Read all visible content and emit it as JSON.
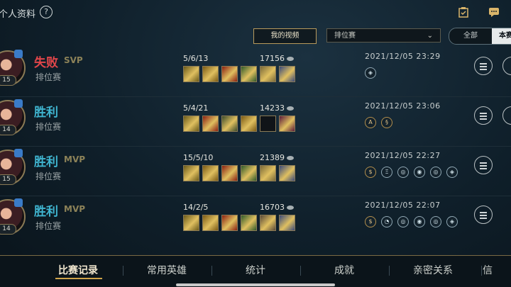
{
  "header": {
    "title": "个人资料",
    "help": "?",
    "video_btn": "我的视频",
    "dropdown_value": "排位赛",
    "seg_all": "全部",
    "seg_this": "本赛"
  },
  "matches": [
    {
      "result": "失败",
      "tag": "SVP",
      "mode": "排位赛",
      "kda": "5/6/13",
      "gold": "17156",
      "date": "2021/12/05 23:29",
      "level": "15",
      "items": [
        "#6b5a1a",
        "#7a5a15",
        "#8a1f12",
        "#2f5a2a",
        "#7a6a3a",
        "#3b4a7a"
      ],
      "icons": [
        {
          "t": "◈",
          "g": false
        }
      ]
    },
    {
      "result": "胜利",
      "tag": "",
      "mode": "排位赛",
      "kda": "5/4/21",
      "gold": "14233",
      "date": "2021/12/05 23:06",
      "level": "14",
      "items": [
        "#6b5a1a",
        "#8a1f12",
        "#3a4a2a",
        "#7a5a15",
        "#101418",
        "#5a1a3a"
      ],
      "icons": [
        {
          "t": "A",
          "g": true
        },
        {
          "t": "§",
          "g": true
        }
      ]
    },
    {
      "result": "胜利",
      "tag": "MVP",
      "mode": "排位赛",
      "kda": "15/5/10",
      "gold": "21389",
      "date": "2021/12/05 22:27",
      "level": "15",
      "items": [
        "#6b5a1a",
        "#7a5a15",
        "#8a1f12",
        "#2f5a2a",
        "#7a6a3a",
        "#3b4a7a"
      ],
      "icons": [
        {
          "t": "$",
          "g": true
        },
        {
          "t": "Ξ",
          "g": false
        },
        {
          "t": "◎",
          "g": false
        },
        {
          "t": "◉",
          "g": false
        },
        {
          "t": "◎",
          "g": false
        },
        {
          "t": "◈",
          "g": false
        }
      ]
    },
    {
      "result": "胜利",
      "tag": "MVP",
      "mode": "排位赛",
      "kda": "14/2/5",
      "gold": "16703",
      "date": "2021/12/05 22:07",
      "level": "14",
      "items": [
        "#6b5a1a",
        "#7a5a15",
        "#8a1f12",
        "#2f5a2a",
        "#5a4a3a",
        "#3b4a7a"
      ],
      "icons": [
        {
          "t": "$",
          "g": true
        },
        {
          "t": "◔",
          "g": false
        },
        {
          "t": "◎",
          "g": false
        },
        {
          "t": "◉",
          "g": false
        },
        {
          "t": "◎",
          "g": false
        },
        {
          "t": "◈",
          "g": false
        }
      ]
    }
  ],
  "nav": {
    "tabs": [
      "比赛记录",
      "常用英雄",
      "统计",
      "成就",
      "亲密关系",
      "信"
    ],
    "active": 0
  }
}
